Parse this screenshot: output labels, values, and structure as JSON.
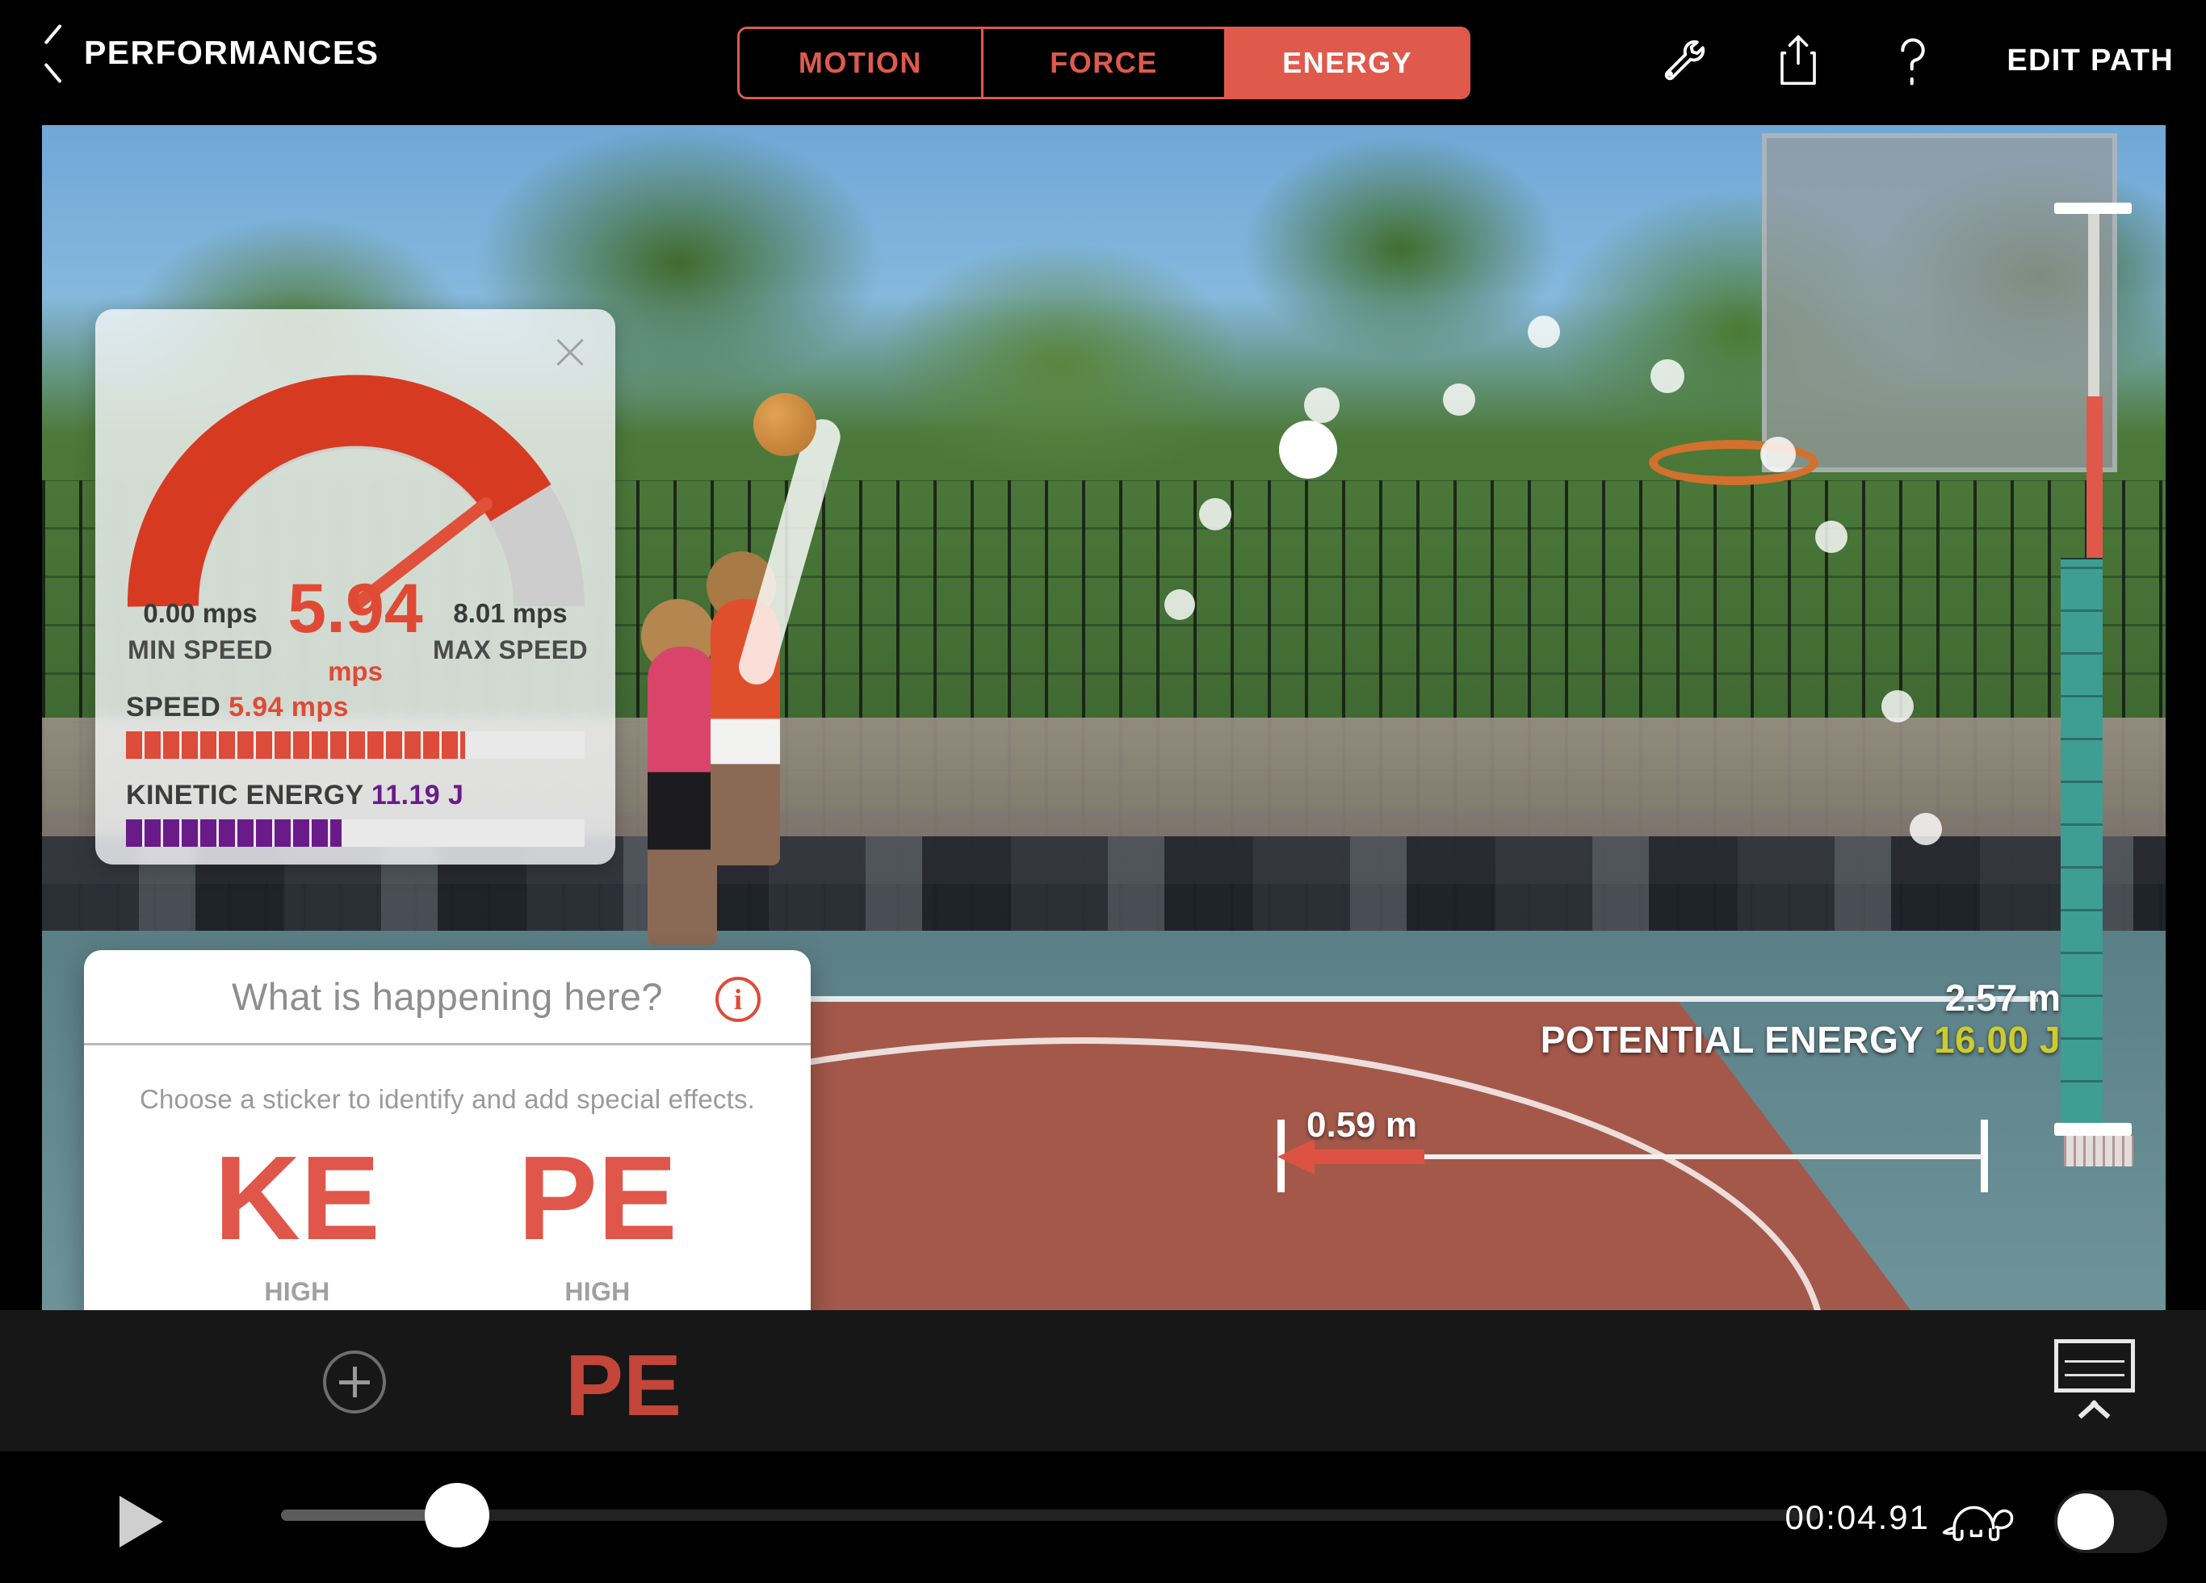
{
  "topbar": {
    "back_label": "PERFORMANCES",
    "back_icon": "chevron-left-icon",
    "tabs": [
      {
        "label": "MOTION",
        "active": false
      },
      {
        "label": "FORCE",
        "active": false
      },
      {
        "label": "ENERGY",
        "active": true
      }
    ],
    "icons": [
      "wrench-icon",
      "share-icon",
      "help-icon"
    ],
    "edit_path_label": "EDIT PATH",
    "accent_color": "#e05a4c"
  },
  "gauge_panel": {
    "close_icon": "close-icon",
    "value": "5.94",
    "unit": "mps",
    "min_value": "0.00 mps",
    "min_caption": "MIN SPEED",
    "max_value": "8.01 mps",
    "max_caption": "MAX SPEED",
    "arc_color": "#d63b22",
    "bars": [
      {
        "label": "SPEED",
        "value": "5.94 mps",
        "color": "#dd4b3a",
        "percent": 74
      },
      {
        "label": "KINETIC ENERGY",
        "value": "11.19 J",
        "color": "#6a1b8a",
        "percent": 47
      }
    ]
  },
  "popover": {
    "title": "What is happening here?",
    "info_icon": "info-icon",
    "info_glyph": "i",
    "subtitle": "Choose a sticker to identify and add special effects.",
    "stickers": [
      {
        "glyph": "KE",
        "caption": "HIGH\nKINETIC ENERGY"
      },
      {
        "glyph": "PE",
        "caption": "HIGH\nPOTENTIAL ENERGY"
      }
    ],
    "sticker_color": "#e0564a"
  },
  "overlays": {
    "height_label": "2.57 m",
    "pe_label": "POTENTIAL ENERGY",
    "pe_value": "16.00 J",
    "pe_value_color": "#cfcb2a",
    "distance_label": "0.59 m",
    "ruler_teal_color": "#3f9e94",
    "ruler_red_color": "#e0584a"
  },
  "trackbar": {
    "add_icon": "plus-circle-icon",
    "sticker_label": "PE",
    "graph_icon": "graph-icon",
    "graph_chevron_icon": "chevron-up-icon"
  },
  "playbar": {
    "play_icon": "play-icon",
    "timecode": "00:04.91",
    "slow_motion_icon": "turtle-icon",
    "toggle_icon": "toggle-switch",
    "toggle_on": false,
    "scrub_percent": 12
  }
}
